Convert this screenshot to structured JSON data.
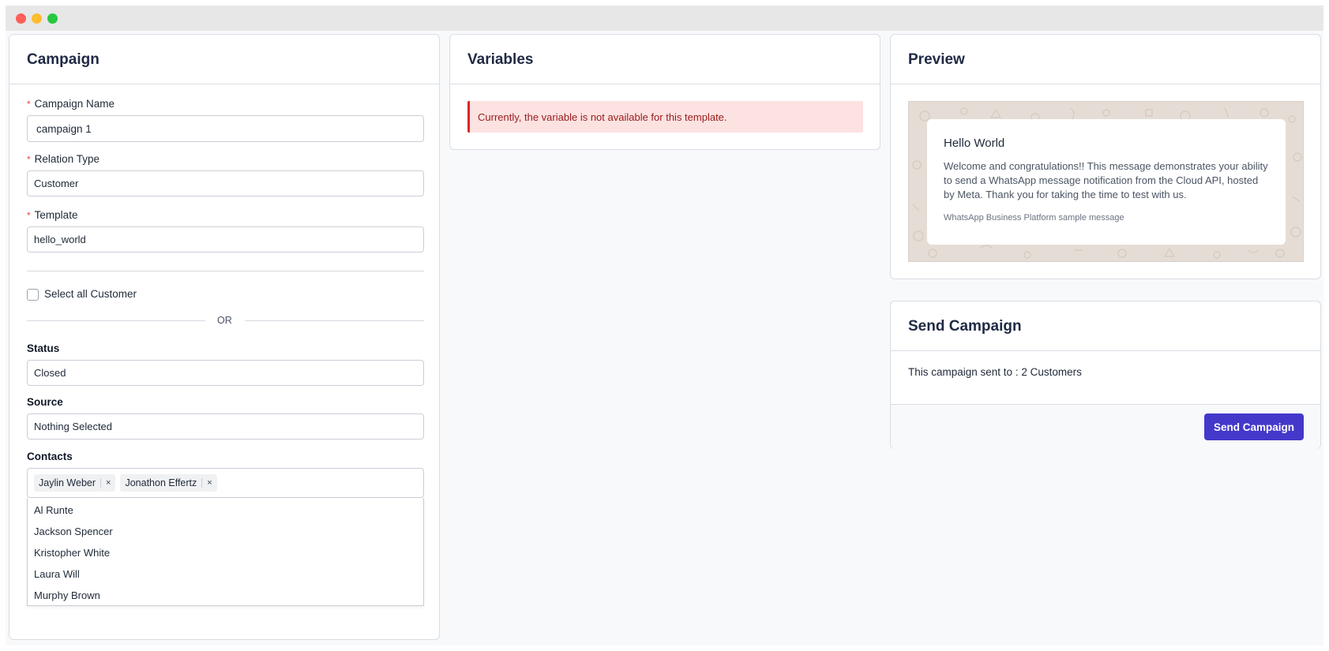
{
  "campaign": {
    "title": "Campaign",
    "required_mark": "*",
    "name_label": "Campaign Name",
    "name_value": "campaign 1",
    "relation_label": "Relation Type",
    "relation_value": "Customer",
    "template_label": "Template",
    "template_value": "hello_world",
    "select_all_label": "Select all Customer",
    "or_text": "OR",
    "status_label": "Status",
    "status_value": "Closed",
    "source_label": "Source",
    "source_value": "Nothing Selected",
    "contacts_label": "Contacts",
    "selected_contacts": [
      "Jaylin Weber",
      "Jonathon Effertz"
    ],
    "remove_glyph": "×",
    "contact_options": [
      "Al Runte",
      "Jackson Spencer",
      "Kristopher White",
      "Laura Will",
      "Murphy Brown"
    ]
  },
  "variables": {
    "title": "Variables",
    "alert_text": "Currently, the variable is not available for this template."
  },
  "preview": {
    "title": "Preview",
    "message_title": "Hello World",
    "message_body": "Welcome and congratulations!! This message demonstrates your ability to send a WhatsApp message notification from the Cloud API, hosted by Meta. Thank you for taking the time to test with us.",
    "message_footer": "WhatsApp Business Platform sample message"
  },
  "send": {
    "title": "Send Campaign",
    "summary_text": "This campaign sent to : 2 Customers",
    "button_label": "Send Campaign"
  },
  "colors": {
    "accent": "#4338ca",
    "alert_bg": "#fde2e2",
    "alert_border": "#dc2626",
    "required": "#ef4444"
  }
}
